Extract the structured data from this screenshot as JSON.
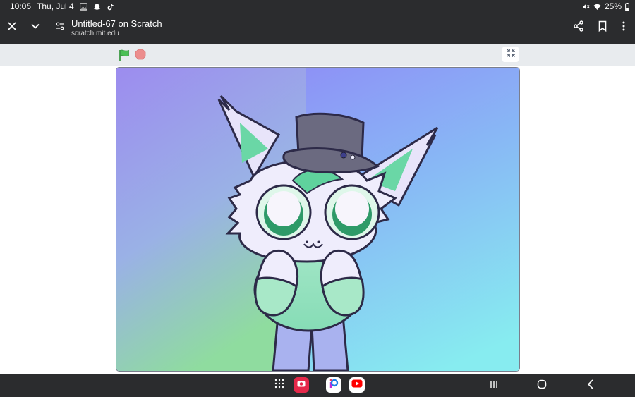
{
  "status_bar": {
    "time": "10:05",
    "date": "Thu, Jul 4",
    "battery": "25%",
    "notification_icons": [
      "gallery-icon",
      "snapchat-icon",
      "tiktok-icon"
    ],
    "system_icons": [
      "mute-icon",
      "wifi-icon",
      "battery-icon"
    ]
  },
  "toolbar": {
    "title": "Untitled-67 on Scratch",
    "url": "scratch.mit.edu",
    "left_icons": [
      "close-icon",
      "chevron-down-icon",
      "site-settings-icon"
    ],
    "right_icons": [
      "share-icon",
      "bookmark-icon",
      "more-icon"
    ]
  },
  "scratch": {
    "controls": [
      "green-flag-icon",
      "stop-icon",
      "exit-fullscreen-icon"
    ],
    "colors": {
      "flag": "#4cbf56",
      "stop": "#ec8d8d",
      "bar": "#e8ebee"
    }
  },
  "nav_bar": {
    "apps": [
      "app-drawer-icon",
      "camera-app-icon",
      "picsart-app-icon",
      "youtube-app-icon"
    ],
    "buttons": [
      "recents-icon",
      "home-icon",
      "back-icon"
    ]
  }
}
